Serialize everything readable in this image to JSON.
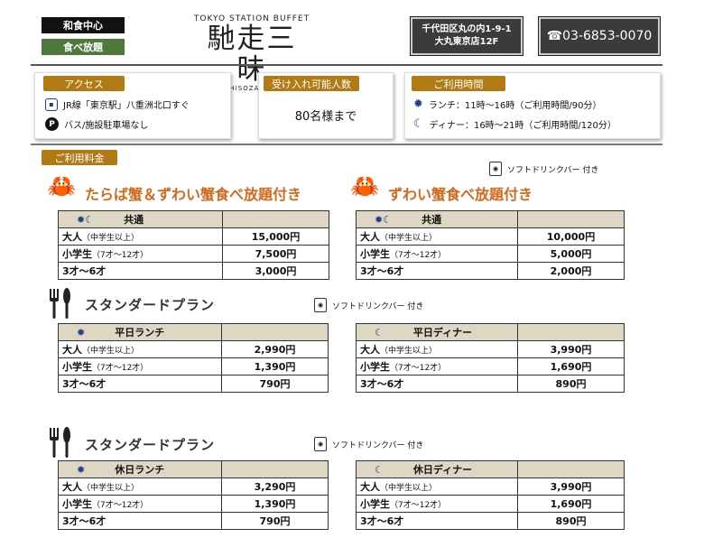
{
  "header": {
    "tag_washoku": "和食中心",
    "tag_tabehodai": "食べ放題",
    "logo_top": "TOKYO STATION BUFFET",
    "logo_main": "馳走三昧",
    "logo_bottom": "CHISOZANMAI",
    "address_line1": "千代田区丸の内1-9-1",
    "address_line2": "大丸東京店12F",
    "phone": "☎03-6853-0070"
  },
  "access": {
    "badge": "アクセス",
    "train_icon": "train-icon",
    "train_text": "JR線「東京駅」八重洲北口すぐ",
    "parking_icon": "parking-icon",
    "parking_text": "バス/施設駐車場なし"
  },
  "capacity": {
    "badge": "受け入れ可能人数",
    "value": "80名様まで"
  },
  "hours": {
    "badge": "ご利用時間",
    "lunch": "ランチ：11時～16時（ご利用時間/90分）",
    "dinner": "ディナー：16時～21時（ご利用時間/120分）"
  },
  "fees_badge": "ご利用料金",
  "drink_note": "ソフトドリンクバー 付き",
  "plans": {
    "crab_all": {
      "title": "たらば蟹＆ずわい蟹食べ放題付き",
      "head": "共通",
      "rows": [
        {
          "label": "大人",
          "sub": "（中学生以上）",
          "price": "15,000円"
        },
        {
          "label": "小学生",
          "sub": "（7才～12才）",
          "price": "7,500円"
        },
        {
          "label": "3才～6才",
          "sub": "",
          "price": "3,000円"
        }
      ]
    },
    "crab_zuwai": {
      "title": "ずわい蟹食べ放題付き",
      "head": "共通",
      "rows": [
        {
          "label": "大人",
          "sub": "（中学生以上）",
          "price": "10,000円"
        },
        {
          "label": "小学生",
          "sub": "（7才～12才）",
          "price": "5,000円"
        },
        {
          "label": "3才～6才",
          "sub": "",
          "price": "2,000円"
        }
      ]
    },
    "standard_title": "スタンダードプラン",
    "weekday_lunch": {
      "head": "平日ランチ",
      "rows": [
        {
          "label": "大人",
          "sub": "（中学生以上）",
          "price": "2,990円"
        },
        {
          "label": "小学生",
          "sub": "（7才～12才）",
          "price": "1,390円"
        },
        {
          "label": "3才～6才",
          "sub": "",
          "price": "790円"
        }
      ]
    },
    "weekday_dinner": {
      "head": "平日ディナー",
      "rows": [
        {
          "label": "大人",
          "sub": "（中学生以上）",
          "price": "3,990円"
        },
        {
          "label": "小学生",
          "sub": "（7才～12才）",
          "price": "1,690円"
        },
        {
          "label": "3才～6才",
          "sub": "",
          "price": "890円"
        }
      ]
    },
    "holiday_lunch": {
      "head": "休日ランチ",
      "rows": [
        {
          "label": "大人",
          "sub": "（中学生以上）",
          "price": "3,290円"
        },
        {
          "label": "小学生",
          "sub": "（7才～12才）",
          "price": "1,390円"
        },
        {
          "label": "3才～6才",
          "sub": "",
          "price": "790円"
        }
      ]
    },
    "holiday_dinner": {
      "head": "休日ディナー",
      "rows": [
        {
          "label": "大人",
          "sub": "（中学生以上）",
          "price": "3,990円"
        },
        {
          "label": "小学生",
          "sub": "（7才～12才）",
          "price": "1,690円"
        },
        {
          "label": "3才～6才",
          "sub": "",
          "price": "890円"
        }
      ]
    }
  },
  "colors": {
    "badge": "#b07a14",
    "accent_title": "#d2691e",
    "table_head": "#ddd7c3",
    "dark_box": "#3b3b3b"
  }
}
